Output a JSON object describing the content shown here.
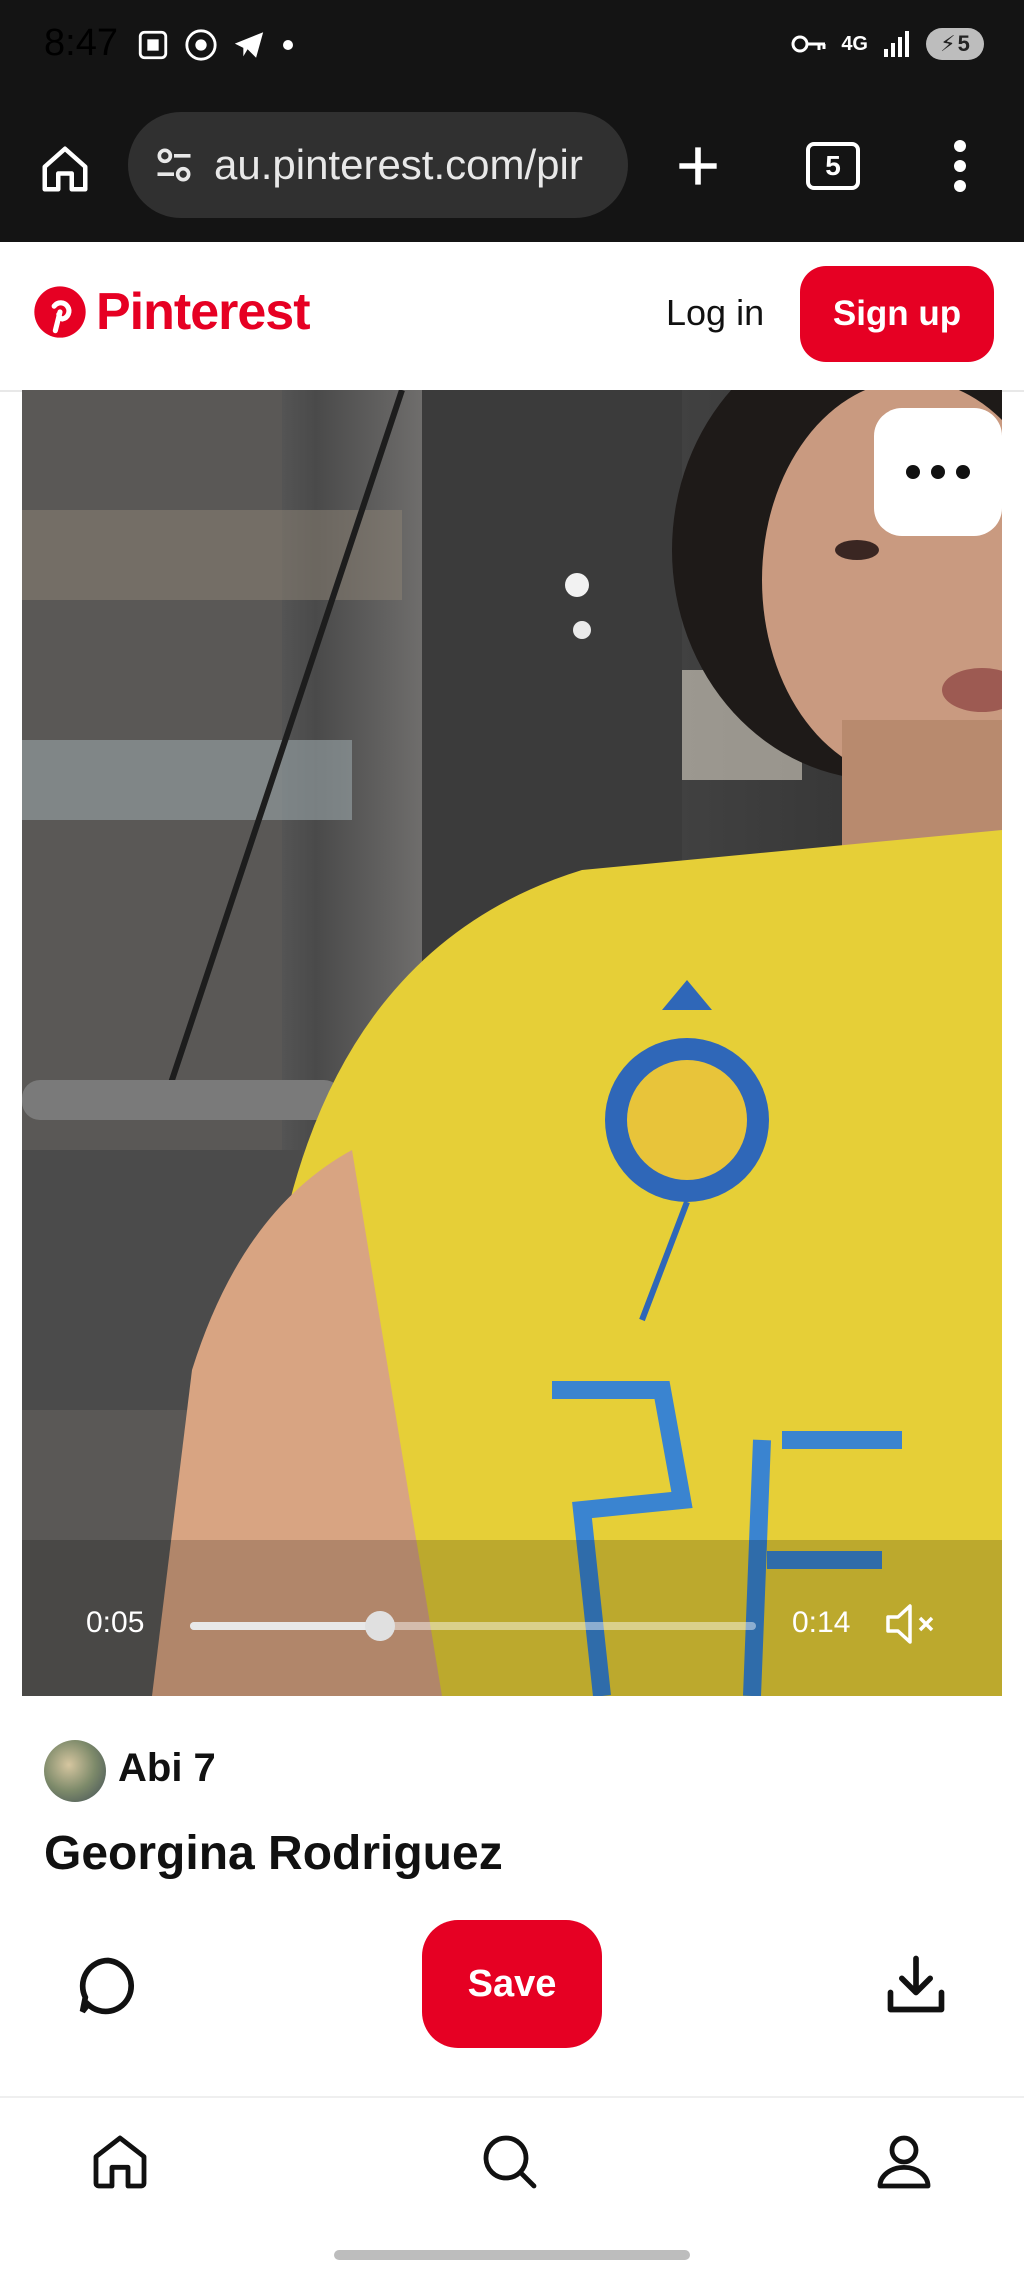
{
  "status_bar": {
    "time": "8:47",
    "network": "4G",
    "battery": "5"
  },
  "browser": {
    "url": "au.pinterest.com/pir",
    "tab_count": "5"
  },
  "pinterest": {
    "logo_text": "Pinterest",
    "login_label": "Log in",
    "signup_label": "Sign up",
    "brand_color": "#e60023"
  },
  "video": {
    "current_time": "0:05",
    "total_time": "0:14",
    "progress_fraction": 0.336,
    "muted": true
  },
  "pin": {
    "username": "Abi 7",
    "title": "Georgina Rodriguez",
    "save_label": "Save"
  },
  "icons": {
    "status": [
      "screenshot-icon",
      "chrome-icon",
      "telegram-icon",
      "dot-icon",
      "key-icon",
      "signal-icon",
      "battery-icon"
    ],
    "browser": [
      "home-icon",
      "site-settings-icon",
      "new-tab-icon",
      "tab-switcher-icon",
      "more-vert-icon"
    ],
    "pin_actions": [
      "comment-icon",
      "download-icon"
    ],
    "bottom_nav": [
      "nav-home-icon",
      "nav-search-icon",
      "nav-profile-icon"
    ]
  }
}
